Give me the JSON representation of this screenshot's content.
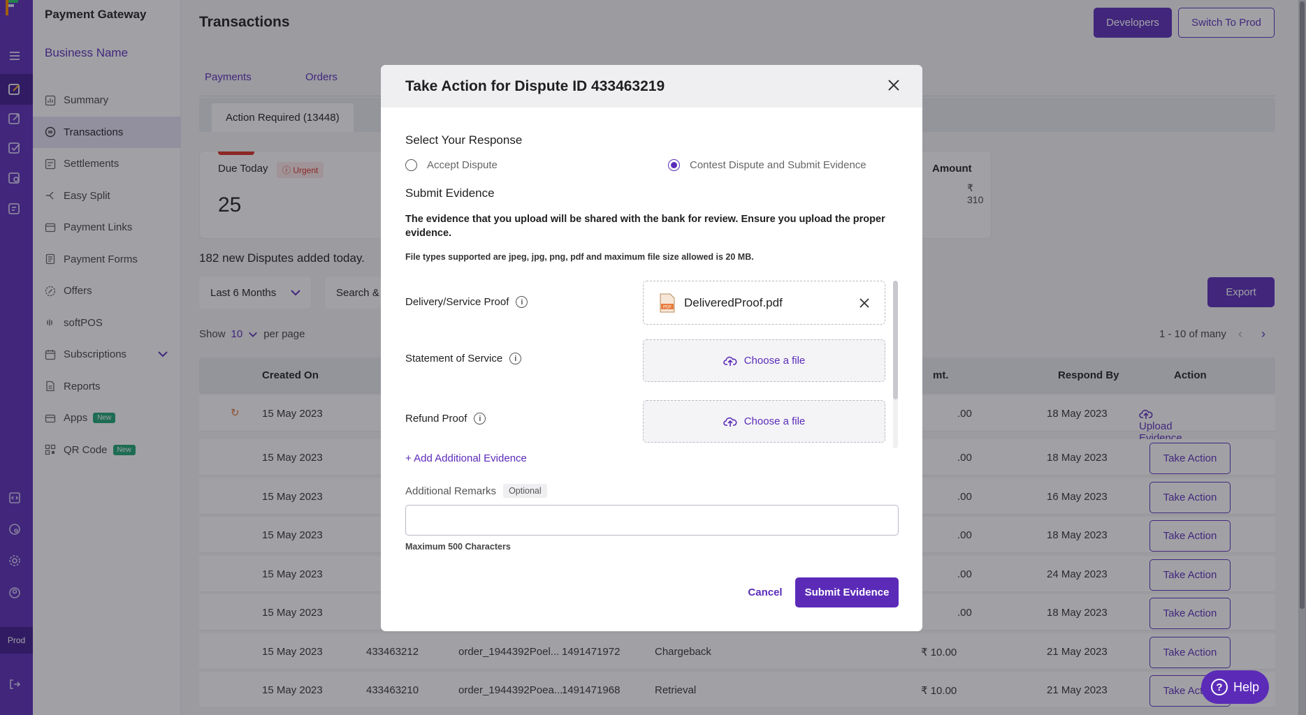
{
  "app": {
    "title": "Payment Gateway",
    "business_name": "Business Name",
    "env_label": "Prod"
  },
  "sidebar": {
    "items": [
      {
        "label": "Summary",
        "icon": "bar-chart-icon"
      },
      {
        "label": "Transactions",
        "icon": "transactions-icon"
      },
      {
        "label": "Settlements",
        "icon": "settlements-icon"
      },
      {
        "label": "Easy Split",
        "icon": "split-icon"
      },
      {
        "label": "Payment Links",
        "icon": "link-icon"
      },
      {
        "label": "Payment Forms",
        "icon": "form-icon"
      },
      {
        "label": "Offers",
        "icon": "offer-icon"
      },
      {
        "label": "softPOS",
        "icon": "nfc-icon"
      },
      {
        "label": "Subscriptions",
        "icon": "calendar-icon"
      },
      {
        "label": "Reports",
        "icon": "report-icon"
      },
      {
        "label": "Apps",
        "icon": "apps-icon",
        "badge": "New"
      },
      {
        "label": "QR Code",
        "icon": "qr-icon",
        "badge": "New"
      }
    ]
  },
  "header": {
    "title": "Transactions",
    "developers_label": "Developers",
    "switch_label": "Switch To Prod"
  },
  "tabs": [
    "Payments",
    "Orders"
  ],
  "subtab_active": "Action Required (13448)",
  "summary_card": {
    "due_label": "Due Today",
    "urgent_label": "Urgent",
    "count": "25",
    "amount_label": "Amount",
    "amount_value": "₹ 310"
  },
  "new_disputes": "182 new Disputes added today.",
  "filters": {
    "period": "Last 6 Months",
    "search": "Search &",
    "export_label": "Export"
  },
  "paging": {
    "show_label": "Show",
    "show_value": "10",
    "per_page": "per page",
    "range": "1 - 10 of many"
  },
  "table": {
    "headers": {
      "created": "Created On",
      "amt": "mt.",
      "respond": "Respond By",
      "action": "Action"
    },
    "rows": [
      {
        "created": "15 May 2023",
        "amt": ".00",
        "respond": "18 May 2023",
        "action": "Upload Evidence"
      },
      {
        "created": "15 May 2023",
        "amt": ".00",
        "respond": "18 May 2023",
        "action": "Take Action"
      },
      {
        "created": "15 May 2023",
        "amt": ".00",
        "respond": "16 May 2023",
        "action": "Take Action"
      },
      {
        "created": "15 May 2023",
        "amt": ".00",
        "respond": "18 May 2023",
        "action": "Take Action"
      },
      {
        "created": "15 May 2023",
        "amt": ".00",
        "respond": "24 May 2023",
        "action": "Take Action"
      },
      {
        "created": "15 May 2023",
        "amt": ".00",
        "respond": "18 May 2023",
        "action": "Take Action"
      },
      {
        "created": "15 May 2023",
        "id": "433463212",
        "order": "order_1944392Poel...",
        "ref": "1491471972",
        "type": "Chargeback",
        "amt": "₹ 10.00",
        "respond": "21 May 2023",
        "action": "Take Action"
      },
      {
        "created": "15 May 2023",
        "id": "433463210",
        "order": "order_1944392Poea...",
        "ref": "1491471968",
        "type": "Retrieval",
        "amt": "₹ 10.00",
        "respond": "21 May 2023",
        "action": "Take Action"
      }
    ]
  },
  "modal": {
    "title": "Take Action for Dispute ID 433463219",
    "response_heading": "Select Your Response",
    "option_accept": "Accept Dispute",
    "option_contest": "Contest Dispute and Submit Evidence",
    "selected_option": "contest",
    "evidence_heading": "Submit Evidence",
    "evidence_text": "The evidence that you upload will be shared with the bank for review. Ensure you upload the proper evidence.",
    "file_types": "File types supported are jpeg, jpg, png, pdf and maximum file size allowed is 20 MB.",
    "evidence": [
      {
        "label": "Delivery/Service Proof",
        "file": "DeliveredProof.pdf"
      },
      {
        "label": "Statement of Service",
        "upload": "Choose a file"
      },
      {
        "label": "Refund Proof",
        "upload": "Choose a file"
      }
    ],
    "add_evidence": "+ Add Additional Evidence",
    "remarks_label": "Additional Remarks",
    "remarks_optional": "Optional",
    "remarks_value": "",
    "max_chars": "Maximum 500 Characters",
    "cancel_label": "Cancel",
    "submit_label": "Submit Evidence"
  },
  "help_label": "Help",
  "colors": {
    "primary": "#5b2bb8",
    "urgent": "#d93025",
    "badge_new": "#1ea672"
  }
}
